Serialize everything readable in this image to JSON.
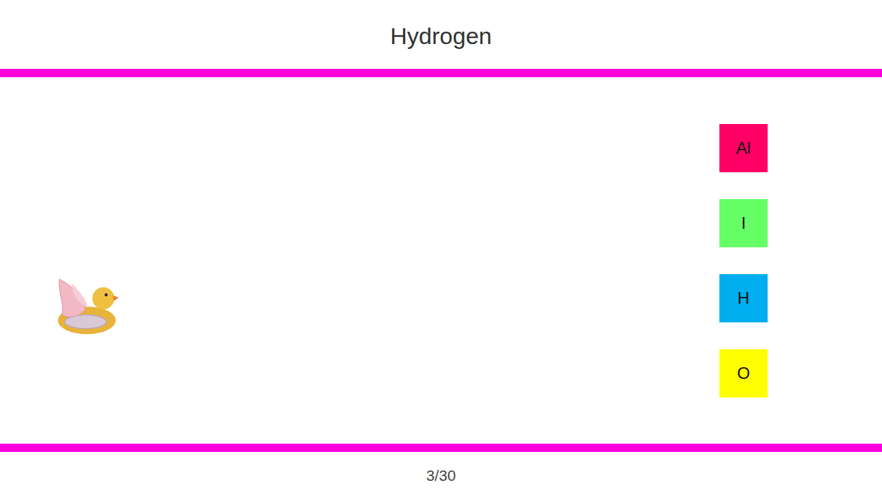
{
  "title": "Hydrogen",
  "choices": [
    {
      "symbol": "Al",
      "color": "#ff0066"
    },
    {
      "symbol": "I",
      "color": "#66ff66"
    },
    {
      "symbol": "H",
      "color": "#00aeef"
    },
    {
      "symbol": "O",
      "color": "#ffff00"
    }
  ],
  "progress": "3/30"
}
